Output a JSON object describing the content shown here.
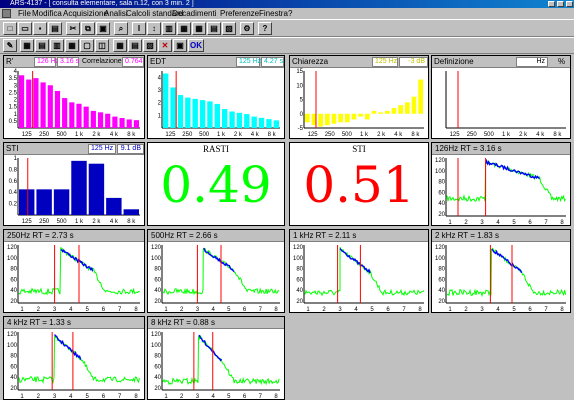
{
  "window": {
    "title": "ARS-4137 - [ consulta elementare, sala n.12, con 3 min. 2 ]"
  },
  "menu": [
    "File",
    "Modifica",
    "Acquisizione",
    "Analisi",
    "Calcoli standard",
    "Decadimenti",
    "Preferenze",
    "Finestra",
    "?"
  ],
  "toolbar2": {
    "ok_label": "OK"
  },
  "octaves": [
    "125",
    "250",
    "500",
    "1 k",
    "2 k",
    "4 k",
    "8 k"
  ],
  "colors": {
    "magenta": "#ff00ff",
    "cyan": "#00ffff",
    "yellow": "#ffff00",
    "blue": "#0000c0",
    "green": "#00ff00",
    "red": "#ff0000",
    "decay_blue": "#0000ff"
  },
  "panels": {
    "rt": {
      "title": "R'",
      "freq": "126 Hz",
      "value": "3.16 s",
      "corr_label": "Correlazione",
      "corr": "0.764",
      "yticks": [
        "4",
        "3.5",
        "3",
        "2.5",
        "2",
        "1.5",
        "1",
        "0.5"
      ],
      "ymax": 4
    },
    "edt": {
      "title": "EDT",
      "freq": "125 Hz",
      "value": "4.27 s",
      "yticks": [
        "4",
        "3",
        "2",
        "1"
      ],
      "ymax": 4.5
    },
    "chiarezza": {
      "title": "Chiarezza",
      "freq": "125 Hz",
      "value": "-3 dB",
      "yticks": [
        "15",
        "10",
        "5",
        "0",
        "-5"
      ],
      "ymin": -5,
      "ymax": 15
    },
    "definizione": {
      "title": "Definizione",
      "freq": "Hz",
      "unit": "%"
    },
    "sti": {
      "title": "STI",
      "freq": "125 Hz",
      "value": "9.1 dB",
      "yticks": [
        "1",
        "0.8",
        "0.6",
        "0.4",
        "0.2"
      ],
      "ymax": 1
    },
    "rasti": {
      "title": "RASTI",
      "value": "0.49"
    },
    "sti_big": {
      "title": "STI",
      "value": "0.51"
    }
  },
  "chart_data": [
    {
      "type": "bar",
      "title": "R'",
      "categories": [
        "125",
        "250",
        "500",
        "1 k",
        "2 k",
        "4 k",
        "8 k"
      ],
      "values": [
        3.7,
        3.4,
        3.5,
        3.2,
        3.0,
        2.6,
        2.1,
        1.8,
        1.7,
        1.5,
        1.2,
        1.1,
        1.0,
        0.8,
        0.7,
        0.6,
        0.55
      ],
      "ylim": [
        0,
        4
      ]
    },
    {
      "type": "bar",
      "title": "EDT",
      "categories": [
        "125",
        "250",
        "500",
        "1 k",
        "2 k",
        "4 k",
        "8 k"
      ],
      "values": [
        4.3,
        3.2,
        2.6,
        2.4,
        2.3,
        2.2,
        2.1,
        1.9,
        1.5,
        1.3,
        1.2,
        1.1,
        0.9,
        0.8,
        0.7,
        0.6
      ],
      "ylim": [
        0,
        4.5
      ]
    },
    {
      "type": "bar",
      "title": "Chiarezza",
      "categories": [
        "125",
        "250",
        "500",
        "1 k",
        "2 k",
        "4 k",
        "8 k"
      ],
      "values": [
        -3,
        -4,
        -4.5,
        -4,
        -3.5,
        -3,
        -3,
        -2,
        -1,
        -2,
        1,
        0.5,
        1,
        2,
        3,
        4,
        6,
        12
      ],
      "ylim": [
        -5,
        15
      ]
    },
    {
      "type": "bar",
      "title": "STI",
      "categories": [
        "125",
        "250",
        "500",
        "1 k",
        "2 k",
        "4 k",
        "8 k"
      ],
      "values": [
        0.45,
        0.45,
        0.45,
        0.95,
        0.9,
        0.3,
        0.1
      ],
      "ylim": [
        0,
        1
      ]
    }
  ],
  "decays": [
    {
      "label": "126Hz  RT = 3.16 s",
      "start": 0.33,
      "fall": 0.45,
      "tail": 0.3,
      "m1": 0.1,
      "m2": 0.33
    },
    {
      "label": "250Hz  RT = 2.73 s",
      "start": 0.35,
      "fall": 0.27,
      "tail": 0.2,
      "m1": 0.3,
      "m2": 0.5
    },
    {
      "label": "500Hz  RT = 2.66 s",
      "start": 0.35,
      "fall": 0.27,
      "tail": 0.2,
      "m1": 0.3,
      "m2": 0.5
    },
    {
      "label": "1 kHz  RT = 2.11 s",
      "start": 0.3,
      "fall": 0.25,
      "tail": 0.18,
      "m1": 0.28,
      "m2": 0.47
    },
    {
      "label": "2 kHz  RT = 1.83 s",
      "start": 0.38,
      "fall": 0.25,
      "tail": 0.18,
      "m1": 0.37,
      "m2": 0.55
    },
    {
      "label": "4 kHz  RT = 1.33 s",
      "start": 0.3,
      "fall": 0.22,
      "tail": 0.18,
      "m1": 0.28,
      "m2": 0.45
    },
    {
      "label": "8 kHz  RT = 0.88 s",
      "start": 0.31,
      "fall": 0.2,
      "tail": 0.15,
      "m1": 0.27,
      "m2": 0.43
    }
  ],
  "decay_yticks": [
    "120",
    "100",
    "80",
    "60",
    "40",
    "20"
  ],
  "decay_xticks": [
    "1",
    "2",
    "3",
    "4",
    "5",
    "6",
    "7",
    "8"
  ]
}
